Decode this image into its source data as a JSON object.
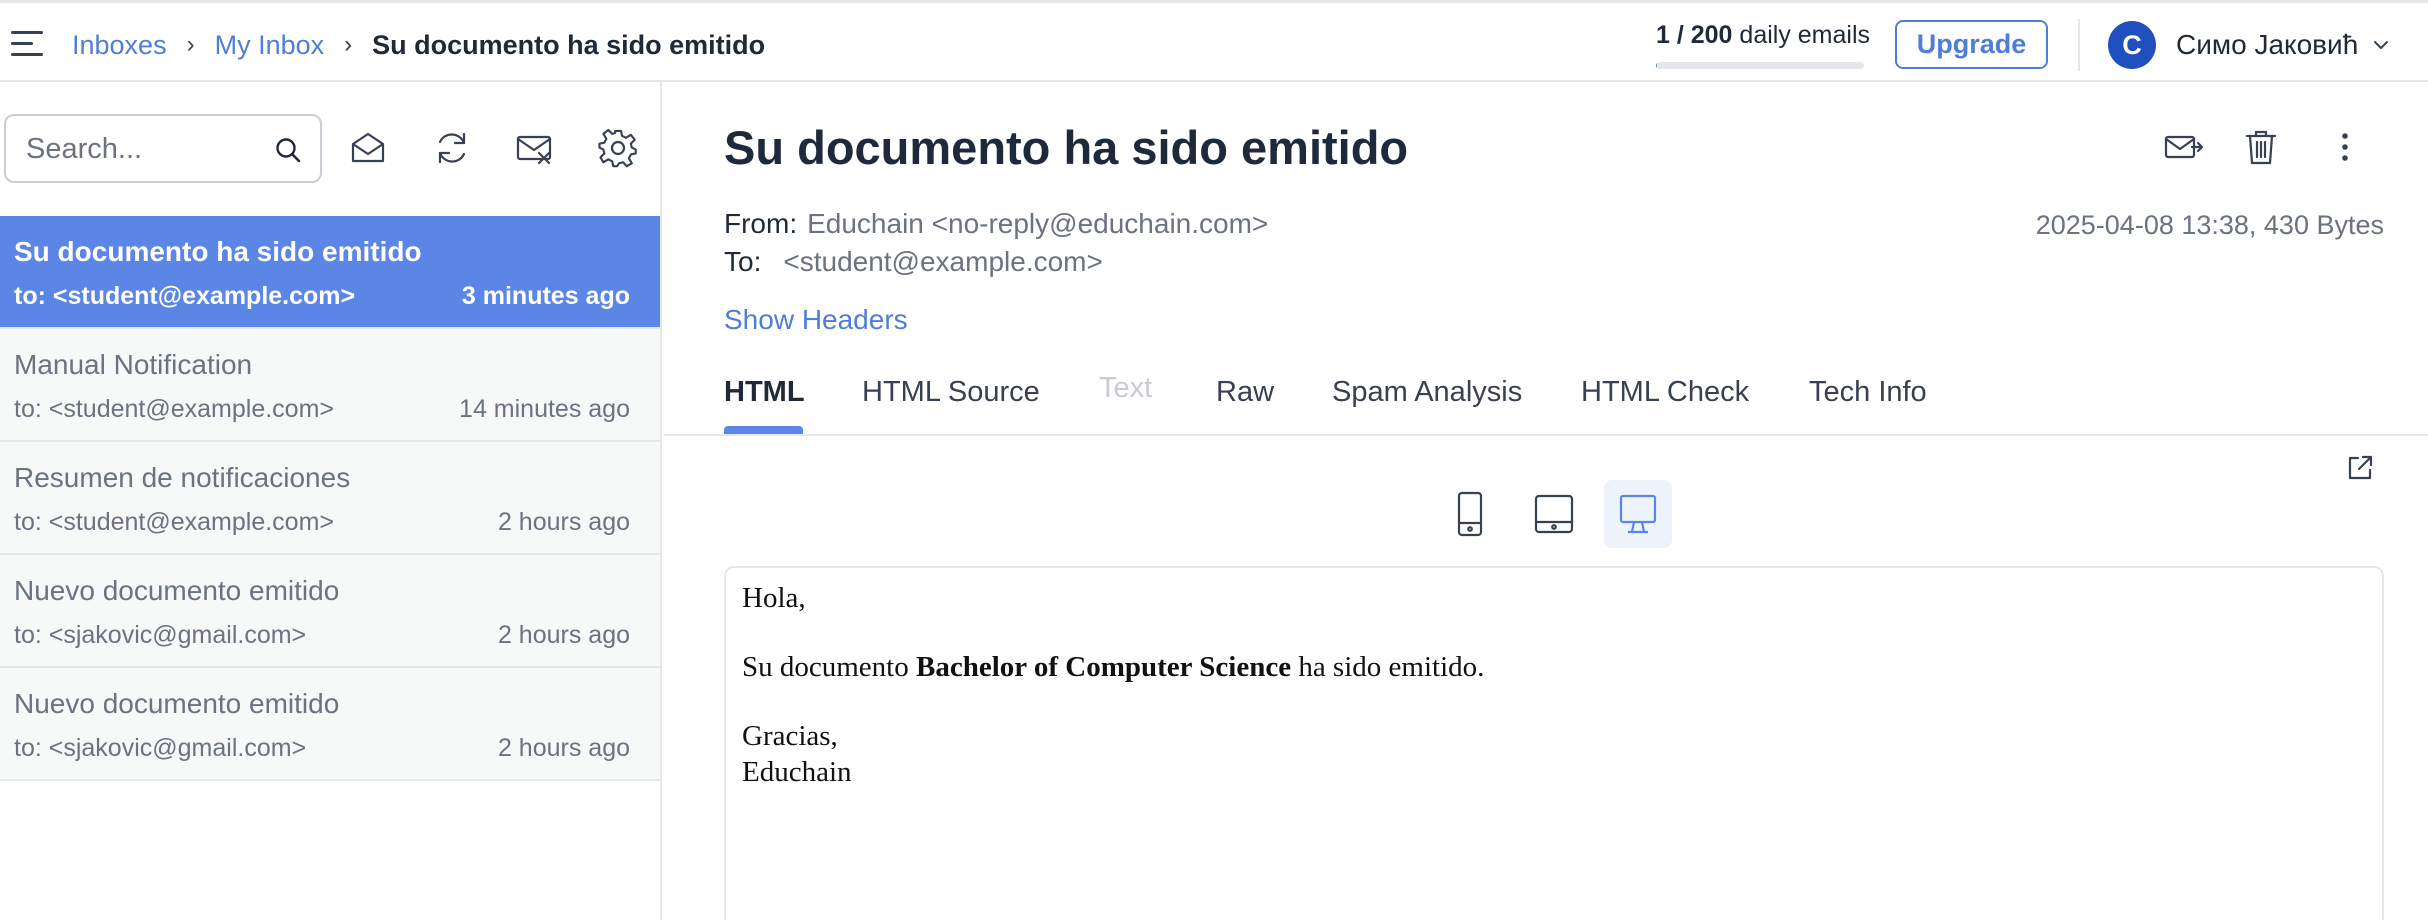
{
  "breadcrumb": {
    "inboxes": "Inboxes",
    "my_inbox": "My Inbox",
    "current": "Su documento ha sido emitido",
    "separator": "›"
  },
  "quota": {
    "used": "1",
    "slash": " / ",
    "total": "200",
    "suffix": " daily emails",
    "fraction": 0.005
  },
  "upgrade_label": "Upgrade",
  "user": {
    "initial": "C",
    "name": "Симо Јаковић"
  },
  "search": {
    "placeholder": "Search..."
  },
  "toolbar_icons": [
    "mail-open-icon",
    "refresh-icon",
    "mail-delete-icon",
    "gear-icon"
  ],
  "messages": [
    {
      "subject": "Su documento ha sido emitido",
      "to": "to: <student@example.com>",
      "time": "3 minutes ago",
      "active": true
    },
    {
      "subject": "Manual Notification",
      "to": "to: <student@example.com>",
      "time": "14 minutes ago"
    },
    {
      "subject": "Resumen de notificaciones",
      "to": "to: <student@example.com>",
      "time": "2 hours ago"
    },
    {
      "subject": "Nuevo documento emitido",
      "to": "to: <sjakovic@gmail.com>",
      "time": "2 hours ago"
    },
    {
      "subject": "Nuevo documento emitido",
      "to": "to: <sjakovic@gmail.com>",
      "time": "2 hours ago"
    }
  ],
  "email": {
    "title": "Su documento ha sido emitido",
    "from_label": "From:",
    "from_value": "Educhain <no-reply@educhain.com>",
    "to_label": "To:",
    "to_value": "<student@example.com>",
    "meta": "2025-04-08 13:38, 430 Bytes",
    "show_headers": "Show Headers"
  },
  "tabs": [
    "HTML",
    "HTML Source",
    "Text",
    "Raw",
    "Spam Analysis",
    "HTML Check",
    "Tech Info"
  ],
  "active_tab": "HTML",
  "disabled_tab": "Text",
  "devices": [
    "mobile-icon",
    "tablet-icon",
    "desktop-icon"
  ],
  "active_device": "desktop-icon",
  "preview": {
    "greeting": "Hola,",
    "line_prefix": "Su documento ",
    "line_bold": "Bachelor of Computer Science",
    "line_suffix": " ha sido emitido.",
    "closing": "Gracias,",
    "signature": "Educhain"
  },
  "colors": {
    "accent": "#4f7ed8",
    "active_row": "#5b86e5",
    "avatar": "#2050c0"
  }
}
